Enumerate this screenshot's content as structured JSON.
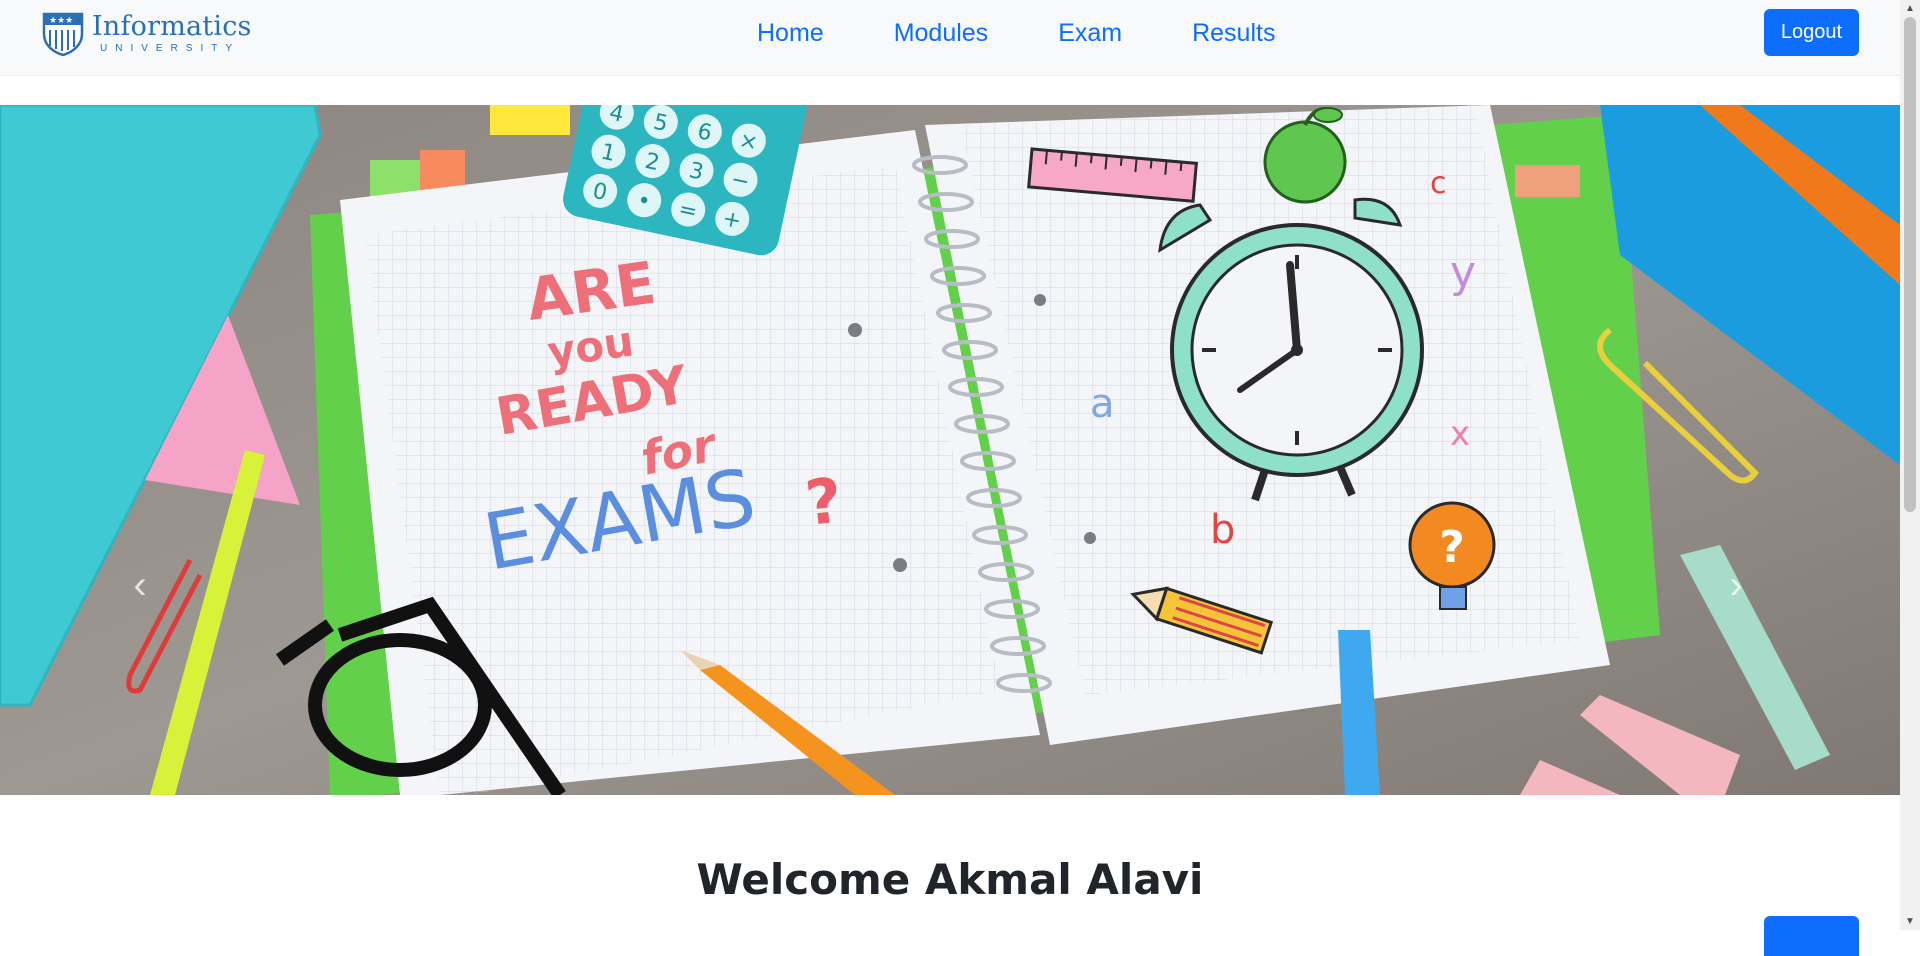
{
  "brand": {
    "name": "Informatics",
    "subtitle": "UNIVERSITY"
  },
  "nav": {
    "items": [
      "Home",
      "Modules",
      "Exam",
      "Results"
    ]
  },
  "logout_label": "Logout",
  "hero": {
    "headline_words": [
      "ARE",
      "you",
      "READY",
      "for",
      "EXAMS",
      "?"
    ],
    "doodle_letters": [
      "c",
      "y",
      "a",
      "x",
      "b"
    ],
    "calculator_keys": [
      "4",
      "5",
      "6",
      "×",
      "1",
      "2",
      "3",
      "−",
      "0",
      "•",
      "=",
      "+"
    ],
    "prev_icon": "chevron-left-icon",
    "next_icon": "chevron-right-icon"
  },
  "welcome_text": "Welcome Akmal Alavi",
  "colors": {
    "accent": "#0d6efd",
    "navbar_bg": "#f8f9fa",
    "text": "#212529"
  }
}
